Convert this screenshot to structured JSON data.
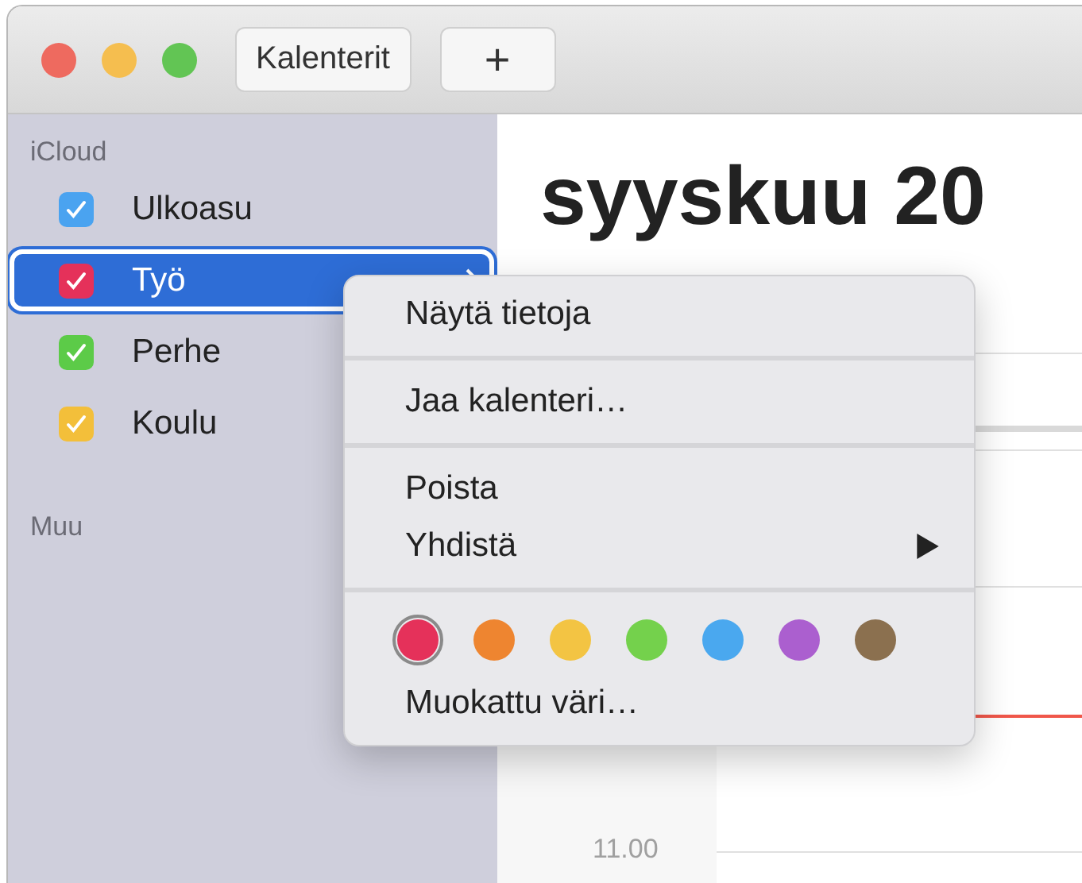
{
  "toolbar": {
    "buttons": [
      {
        "kind": "text",
        "label": "Kalenterit"
      },
      {
        "kind": "add",
        "label": "+"
      }
    ]
  },
  "sidebar": {
    "groups": [
      {
        "title": "iCloud",
        "calendars": [
          {
            "name": "Ulkoasu",
            "checked": true,
            "color": "#4aa3f0",
            "selected": false
          },
          {
            "name": "Työ",
            "checked": true,
            "color": "#e5315a",
            "selected": true
          },
          {
            "name": "Perhe",
            "checked": true,
            "color": "#5ccb48",
            "selected": false
          },
          {
            "name": "Koulu",
            "checked": true,
            "color": "#f3bf3a",
            "selected": false
          }
        ]
      },
      {
        "title": "Muu"
      }
    ]
  },
  "main": {
    "title": "syyskuu 20",
    "time_label": "11.00"
  },
  "context_menu": {
    "sections": [
      [
        {
          "label": "Näytä tietoja",
          "submenu": false
        }
      ],
      [
        {
          "label": "Jaa kalenteri…",
          "submenu": false
        }
      ],
      [
        {
          "label": "Poista",
          "submenu": false
        },
        {
          "label": "Yhdistä",
          "submenu": true
        }
      ]
    ],
    "colors": [
      {
        "color": "#e5315a",
        "selected": true
      },
      {
        "color": "#ee8530",
        "selected": false
      },
      {
        "color": "#f3c443",
        "selected": false
      },
      {
        "color": "#74d14c",
        "selected": false
      },
      {
        "color": "#4aa8ef",
        "selected": false
      },
      {
        "color": "#ab5fcf",
        "selected": false
      },
      {
        "color": "#8b704f",
        "selected": false
      }
    ],
    "custom_color": "Muokattu väri…"
  }
}
